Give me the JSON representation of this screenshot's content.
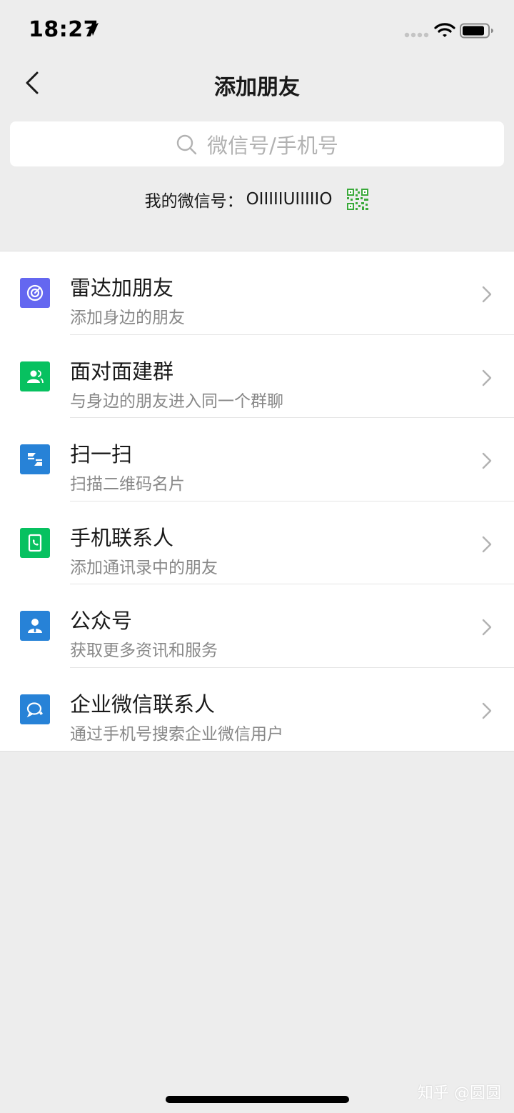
{
  "status_bar": {
    "time": "18:27"
  },
  "nav": {
    "title": "添加朋友"
  },
  "search": {
    "placeholder": "微信号/手机号"
  },
  "my_id": {
    "label": "我的微信号：",
    "value": "OIIIIIUIIIIIO"
  },
  "items": [
    {
      "title": "雷达加朋友",
      "subtitle": "添加身边的朋友",
      "icon": "radar-icon",
      "color": "#6467f0"
    },
    {
      "title": "面对面建群",
      "subtitle": "与身边的朋友进入同一个群聊",
      "icon": "group-icon",
      "color": "#07c160"
    },
    {
      "title": "扫一扫",
      "subtitle": "扫描二维码名片",
      "icon": "scan-icon",
      "color": "#2782d7"
    },
    {
      "title": "手机联系人",
      "subtitle": "添加通讯录中的朋友",
      "icon": "phone-icon",
      "color": "#07c160"
    },
    {
      "title": "公众号",
      "subtitle": "获取更多资讯和服务",
      "icon": "official-account-icon",
      "color": "#2782d7"
    },
    {
      "title": "企业微信联系人",
      "subtitle": "通过手机号搜索企业微信用户",
      "icon": "wecom-icon",
      "color": "#2782d7"
    }
  ],
  "watermark": "知乎 @圆圆",
  "colors": {
    "background": "#ededed",
    "accent_green": "#07c160",
    "qr_green": "#3aa93a"
  }
}
